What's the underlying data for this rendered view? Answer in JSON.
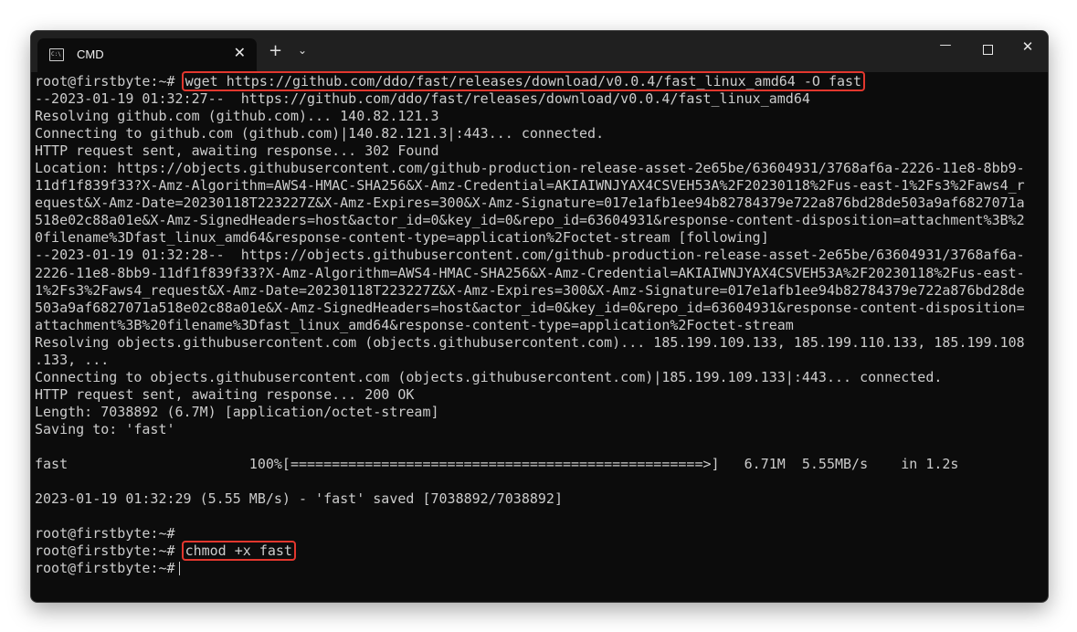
{
  "window": {
    "tab_title": "CMD",
    "tab_close": "✕",
    "new_tab": "+",
    "tab_dropdown": "⌄",
    "minimize": "—",
    "close": "✕"
  },
  "terminal": {
    "prompt": "root@firstbyte:~#",
    "cmd1": "wget https://github.com/ddo/fast/releases/download/v0.0.4/fast_linux_amd64 -O fast",
    "cmd2": "chmod +x fast",
    "lines": [
      "--2023-01-19 01:32:27--  https://github.com/ddo/fast/releases/download/v0.0.4/fast_linux_amd64",
      "Resolving github.com (github.com)... 140.82.121.3",
      "Connecting to github.com (github.com)|140.82.121.3|:443... connected.",
      "HTTP request sent, awaiting response... 302 Found",
      "Location: https://objects.githubusercontent.com/github-production-release-asset-2e65be/63604931/3768af6a-2226-11e8-8bb9-",
      "11df1f839f33?X-Amz-Algorithm=AWS4-HMAC-SHA256&X-Amz-Credential=AKIAIWNJYAX4CSVEH53A%2F20230118%2Fus-east-1%2Fs3%2Faws4_r",
      "equest&X-Amz-Date=20230118T223227Z&X-Amz-Expires=300&X-Amz-Signature=017e1afb1ee94b82784379e722a876bd28de503a9af6827071a",
      "518e02c88a01e&X-Amz-SignedHeaders=host&actor_id=0&key_id=0&repo_id=63604931&response-content-disposition=attachment%3B%2",
      "0filename%3Dfast_linux_amd64&response-content-type=application%2Foctet-stream [following]",
      "--2023-01-19 01:32:28--  https://objects.githubusercontent.com/github-production-release-asset-2e65be/63604931/3768af6a-",
      "2226-11e8-8bb9-11df1f839f33?X-Amz-Algorithm=AWS4-HMAC-SHA256&X-Amz-Credential=AKIAIWNJYAX4CSVEH53A%2F20230118%2Fus-east-",
      "1%2Fs3%2Faws4_request&X-Amz-Date=20230118T223227Z&X-Amz-Expires=300&X-Amz-Signature=017e1afb1ee94b82784379e722a876bd28de",
      "503a9af6827071a518e02c88a01e&X-Amz-SignedHeaders=host&actor_id=0&key_id=0&repo_id=63604931&response-content-disposition=",
      "attachment%3B%20filename%3Dfast_linux_amd64&response-content-type=application%2Foctet-stream",
      "Resolving objects.githubusercontent.com (objects.githubusercontent.com)... 185.199.109.133, 185.199.110.133, 185.199.108",
      ".133, ...",
      "Connecting to objects.githubusercontent.com (objects.githubusercontent.com)|185.199.109.133|:443... connected.",
      "HTTP request sent, awaiting response... 200 OK",
      "Length: 7038892 (6.7M) [application/octet-stream]",
      "Saving to: 'fast'",
      "",
      "fast                      100%[==================================================>]   6.71M  5.55MB/s    in 1.2s",
      "",
      "2023-01-19 01:32:29 (5.55 MB/s) - 'fast' saved [7038892/7038892]",
      ""
    ]
  }
}
